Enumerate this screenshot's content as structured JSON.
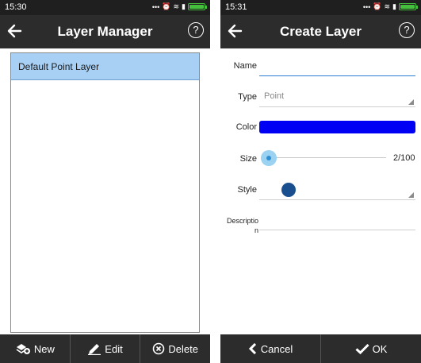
{
  "left_screen": {
    "status": {
      "time": "15:30"
    },
    "appbar": {
      "title": "Layer Manager",
      "help": "?"
    },
    "layers": [
      {
        "label": "Default Point Layer"
      }
    ],
    "bottom_bar": {
      "new_label": "New",
      "edit_label": "Edit",
      "delete_label": "Delete"
    }
  },
  "right_screen": {
    "status": {
      "time": "15:31"
    },
    "appbar": {
      "title": "Create Layer",
      "help": "?"
    },
    "form": {
      "name_label": "Name",
      "name_value": "",
      "type_label": "Type",
      "type_value": "Point",
      "color_label": "Color",
      "color_value": "#0000f5",
      "size_label": "Size",
      "size_value": "2/100",
      "size_fraction": 0.02,
      "style_label": "Style",
      "style_color": "#1a4f8f",
      "description_label": "Descriptio n"
    },
    "bottom_bar": {
      "cancel_label": "Cancel",
      "ok_label": "OK"
    }
  },
  "colors": {
    "toolbar": "#2c2c2c",
    "selected_row": "#a8d0f5",
    "accent": "#2a7fd4",
    "battery": "#44c03c"
  }
}
